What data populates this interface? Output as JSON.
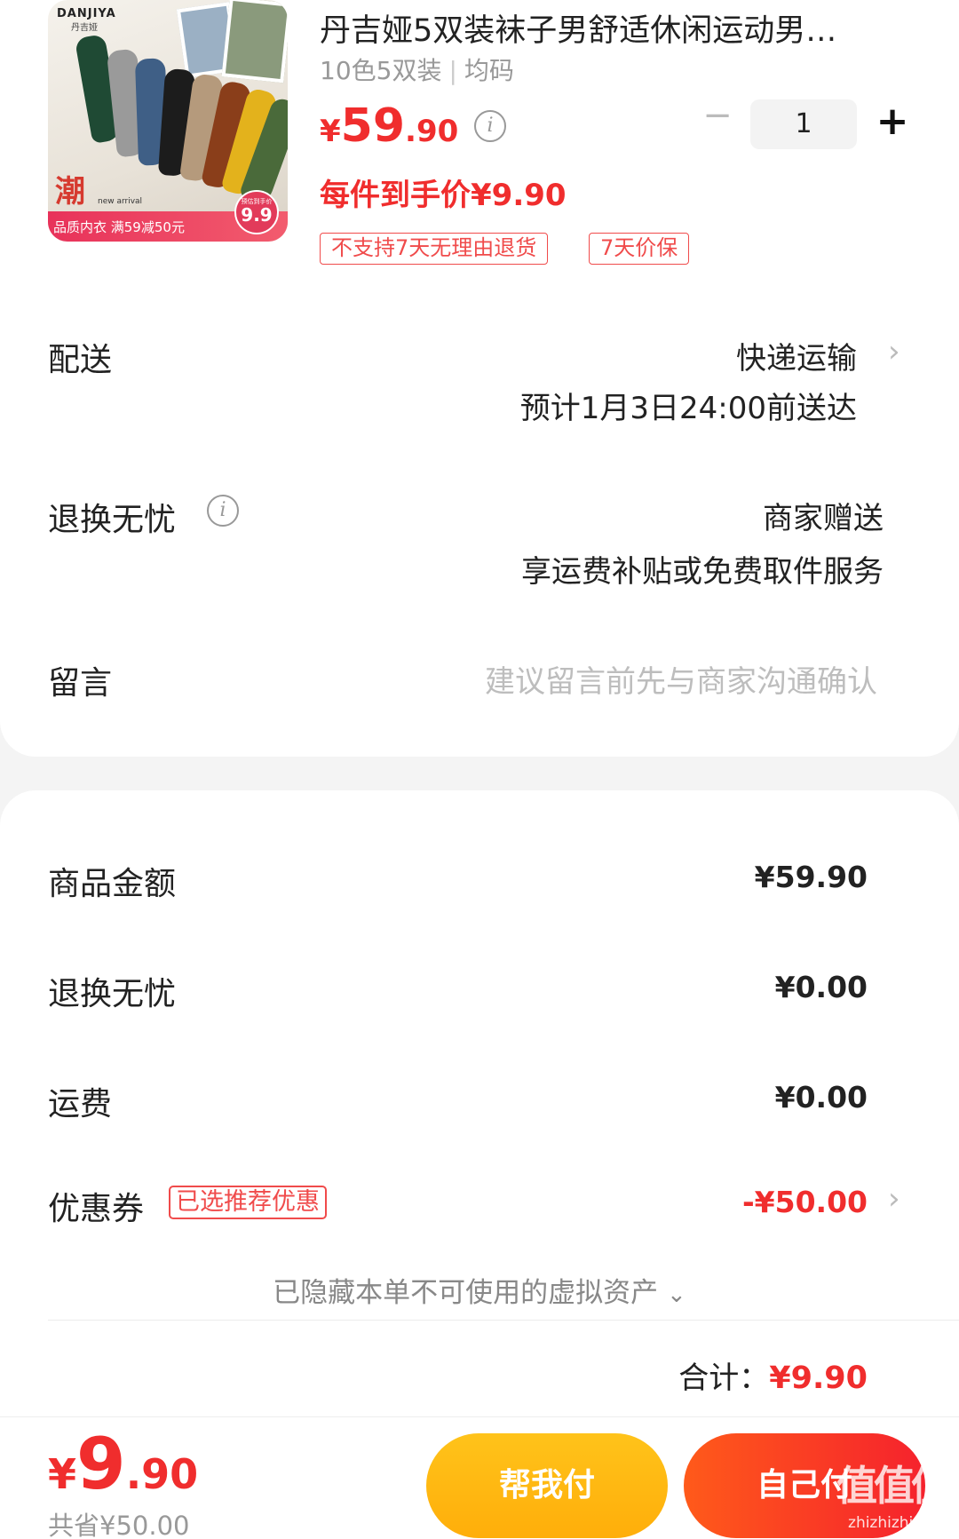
{
  "product": {
    "image": {
      "brand": "DANJIYA",
      "brand_sub": "丹吉娅",
      "chao": "潮",
      "arrival": "new arrival",
      "banner": "品质内衣 满59减50元",
      "tag_small": "预估到手价",
      "tag_price": "9.9"
    },
    "title": "丹吉娅5双装袜子男舒适休闲运动男…",
    "spec_colors": "10色5双装",
    "spec_size": "均码",
    "price_yen": "¥",
    "price_int": "59",
    "price_dec": ".90",
    "per_item_price": "每件到手价¥9.90",
    "quantity": "1",
    "tags": [
      "不支持7天无理由退货",
      "7天价保"
    ]
  },
  "delivery": {
    "label": "配送",
    "method": "快递运输",
    "eta": "预计1月3日24:00前送达"
  },
  "return_worry_free": {
    "label": "退换无忧",
    "provider": "商家赠送",
    "desc": "享运费补贴或免费取件服务"
  },
  "message": {
    "label": "留言",
    "placeholder": "建议留言前先与商家沟通确认"
  },
  "summary": {
    "goods_amount_label": "商品金额",
    "goods_amount": "¥59.90",
    "return_label": "退换无忧",
    "return_amount": "¥0.00",
    "shipping_label": "运费",
    "shipping_amount": "¥0.00",
    "coupon_label": "优惠券",
    "coupon_badge": "已选推荐优惠",
    "coupon_amount": "-¥50.00",
    "hidden_assets": "已隐藏本单不可使用的虚拟资产",
    "total_label": "合计：",
    "total_amount": "¥9.90"
  },
  "footer": {
    "price_yen": "¥",
    "price_int": "9",
    "price_dec": ".90",
    "saved": "共省¥50.00",
    "help_pay": "帮我付",
    "self_pay": "自己付",
    "watermark_logo": "值值值",
    "watermark": "zhizhizhi.com"
  },
  "colors": {
    "accent_red": "#f02d2d",
    "help_button": "#ffb814",
    "self_button": "#f5222d"
  }
}
